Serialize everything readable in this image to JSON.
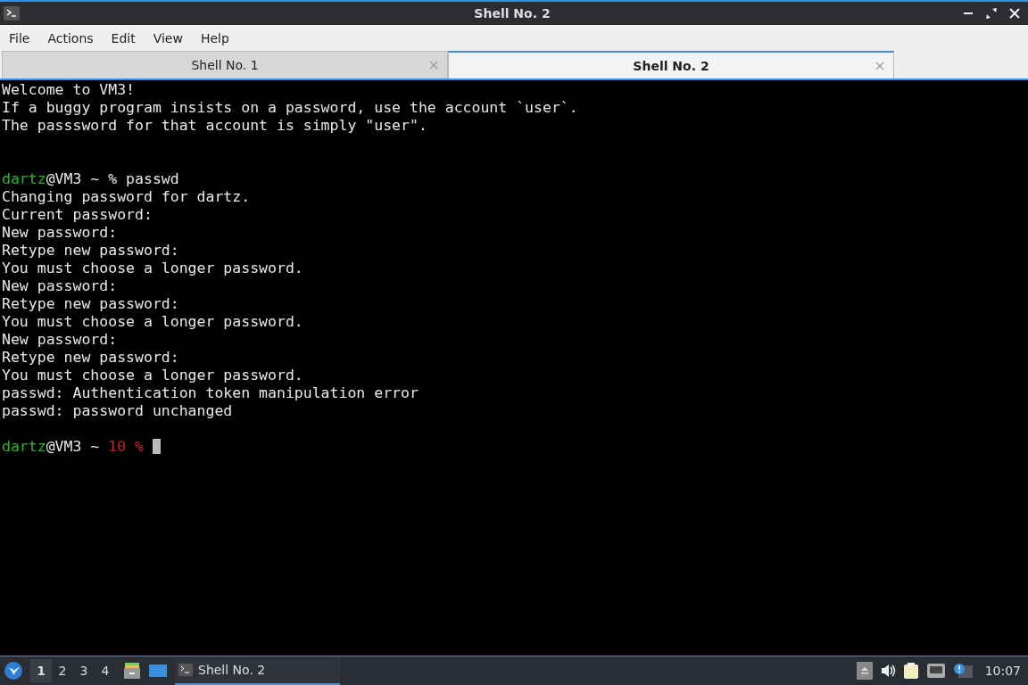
{
  "window": {
    "title": "Shell No. 2"
  },
  "menu": [
    "File",
    "Actions",
    "Edit",
    "View",
    "Help"
  ],
  "tabs": [
    {
      "label": "Shell No. 1",
      "selected": false
    },
    {
      "label": "Shell No. 2",
      "selected": true
    }
  ],
  "terminal": {
    "cursor": true,
    "lines": [
      {
        "kind": "text",
        "segments": [
          {
            "color": "#e8e8e8",
            "text": "Welcome to VM3!"
          }
        ]
      },
      {
        "kind": "text",
        "segments": [
          {
            "color": "#e8e8e8",
            "text": "If a buggy program insists on a password, use the account `user`."
          }
        ]
      },
      {
        "kind": "text",
        "segments": [
          {
            "color": "#e8e8e8",
            "text": "The passsword for that account is simply \"user\"."
          }
        ]
      },
      {
        "kind": "blank"
      },
      {
        "kind": "blank"
      },
      {
        "kind": "text",
        "segments": [
          {
            "color": "#2eb82e",
            "text": "dartz"
          },
          {
            "color": "#e8e8e8",
            "text": "@VM3 ~ % passwd"
          }
        ]
      },
      {
        "kind": "text",
        "segments": [
          {
            "color": "#e8e8e8",
            "text": "Changing password for dartz."
          }
        ]
      },
      {
        "kind": "text",
        "segments": [
          {
            "color": "#e8e8e8",
            "text": "Current password:"
          }
        ]
      },
      {
        "kind": "text",
        "segments": [
          {
            "color": "#e8e8e8",
            "text": "New password:"
          }
        ]
      },
      {
        "kind": "text",
        "segments": [
          {
            "color": "#e8e8e8",
            "text": "Retype new password:"
          }
        ]
      },
      {
        "kind": "text",
        "segments": [
          {
            "color": "#e8e8e8",
            "text": "You must choose a longer password."
          }
        ]
      },
      {
        "kind": "text",
        "segments": [
          {
            "color": "#e8e8e8",
            "text": "New password:"
          }
        ]
      },
      {
        "kind": "text",
        "segments": [
          {
            "color": "#e8e8e8",
            "text": "Retype new password:"
          }
        ]
      },
      {
        "kind": "text",
        "segments": [
          {
            "color": "#e8e8e8",
            "text": "You must choose a longer password."
          }
        ]
      },
      {
        "kind": "text",
        "segments": [
          {
            "color": "#e8e8e8",
            "text": "New password:"
          }
        ]
      },
      {
        "kind": "text",
        "segments": [
          {
            "color": "#e8e8e8",
            "text": "Retype new password:"
          }
        ]
      },
      {
        "kind": "text",
        "segments": [
          {
            "color": "#e8e8e8",
            "text": "You must choose a longer password."
          }
        ]
      },
      {
        "kind": "text",
        "segments": [
          {
            "color": "#e8e8e8",
            "text": "passwd: Authentication token manipulation error"
          }
        ]
      },
      {
        "kind": "text",
        "segments": [
          {
            "color": "#e8e8e8",
            "text": "passwd: password unchanged"
          }
        ]
      },
      {
        "kind": "blank"
      },
      {
        "kind": "text",
        "segments": [
          {
            "color": "#2eb82e",
            "text": "dartz"
          },
          {
            "color": "#e8e8e8",
            "text": "@VM3 ~ "
          },
          {
            "color": "#c0242a",
            "text": "10 %"
          }
        ]
      }
    ]
  },
  "taskbar": {
    "desktops": [
      {
        "label": "1",
        "selected": true
      },
      {
        "label": "2",
        "selected": false
      },
      {
        "label": "3",
        "selected": false
      },
      {
        "label": "4",
        "selected": false
      }
    ],
    "task": {
      "label": "Shell No. 2",
      "selected": true
    },
    "clock": "10:07"
  }
}
